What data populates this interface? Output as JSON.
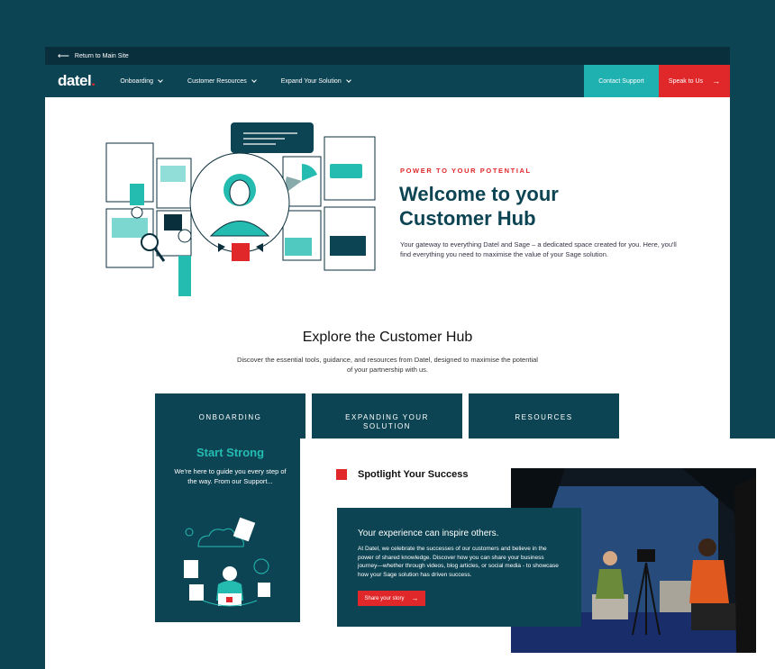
{
  "topbar": {
    "return_label": "Return to Main Site",
    "arrow_icon": "arrow-left-icon"
  },
  "nav": {
    "logo_text": "datel",
    "logo_dot": ".",
    "items": [
      {
        "label": "Onboarding"
      },
      {
        "label": "Customer Resources"
      },
      {
        "label": "Expand Your Solution"
      }
    ],
    "contact_label": "Contact Support",
    "speak_label": "Speak to Us"
  },
  "hero": {
    "eyebrow": "POWER TO YOUR POTENTIAL",
    "title_line1": "Welcome to your",
    "title_line2": "Customer Hub",
    "description": "Your gateway to everything Datel and Sage – a dedicated space created for you. Here, you'll find everything you need to maximise the value of your Sage solution."
  },
  "explore": {
    "title": "Explore the Customer Hub",
    "description": "Discover the essential tools, guidance, and resources from Datel, designed to maximise the potential of your partnership with us."
  },
  "cards": [
    {
      "label": "ONBOARDING",
      "subtitle": "Start Strong",
      "text": "We're here to guide you every step of the way. From our Support..."
    },
    {
      "label": "EXPANDING YOUR SOLUTION"
    },
    {
      "label": "RESOURCES"
    }
  ],
  "spotlight": {
    "title": "Spotlight Your Success",
    "heading": "Your experience can inspire others.",
    "body": "At Datel, we celebrate the successes of our customers and believe in the power of shared knowledge. Discover how you can share your business journey—whether through videos, blog articles, or social media - to showcase how your Sage solution has driven success.",
    "button_label": "Share your story"
  },
  "colors": {
    "navy": "#0d4453",
    "teal": "#1fb0b0",
    "red": "#e0282a",
    "dark": "#0a2f3c"
  }
}
